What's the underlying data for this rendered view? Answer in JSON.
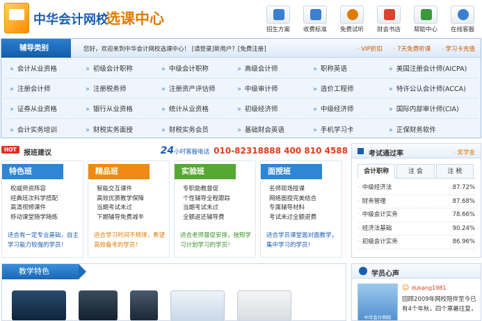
{
  "header": {
    "logo_text": "中华会计网校",
    "logo_sub": "选课中心",
    "nav": [
      {
        "label": "招生方案",
        "icon": "plan-icon",
        "color": "#3a7fd0"
      },
      {
        "label": "收费标准",
        "icon": "fee-icon",
        "color": "#3a7fd0"
      },
      {
        "label": "免费试听",
        "icon": "headphones-icon",
        "color": "#e07b00"
      },
      {
        "label": "财会书店",
        "icon": "book-icon",
        "color": "#d8442f"
      },
      {
        "label": "帮助中心",
        "icon": "help-icon",
        "color": "#3a9a3a"
      },
      {
        "label": "在线客服",
        "icon": "chat-icon",
        "color": "#3a7fd0"
      }
    ]
  },
  "category": {
    "title": "辅导类别",
    "welcome": "您好，欢迎来到中华会计网校选课中心！",
    "login": "[请登录]",
    "new_user": "新用户？",
    "register": "[免费注册]",
    "promos": [
      "· VIP折扣",
      "· 7天免费听课",
      "· 学习卡充值"
    ],
    "rows": [
      [
        "会计从业资格",
        "初级会计职称",
        "中级会计职称",
        "高级会计师",
        "职称英语",
        "美国注册会计师(AICPA)"
      ],
      [
        "注册会计师",
        "注册税务师",
        "注册资产评估师",
        "中级审计师",
        "造价工程师",
        "特许公认会计师(ACCA)"
      ],
      [
        "证券从业资格",
        "银行从业资格",
        "统计从业资格",
        "初级经济师",
        "中级经济师",
        "国际内部审计师(CIA)"
      ],
      [
        "会计实务培训",
        "财税实务面授",
        "财税实务会员",
        "基础财会英语",
        "手机学习卡",
        "正保财务软件"
      ]
    ]
  },
  "hot": {
    "badge": "HOT",
    "title": "报班建议",
    "hotline_24": "24",
    "hotline_label": "小时客服电话",
    "phone": "010-82318888  400 810 4588"
  },
  "cards": [
    {
      "title": "特色班",
      "color": "#2e86d6",
      "items": [
        "权威师资阵容",
        "经典班次科学搭配",
        "高清视频课件",
        "移动课堂随学随练"
      ],
      "foot": "适合有一定专业基础，自主学习能力较强的学员！",
      "foot_color": "#1a5dad"
    },
    {
      "title": "精品班",
      "color": "#f08a12",
      "items": [
        "智能交互课件",
        "高效优质教学保障",
        "当期考试未过",
        "下期辅导免费减半"
      ],
      "foot": "适合学习时间不规律，希望高效备考的学员！",
      "foot_color": "#e07b00"
    },
    {
      "title": "实验班",
      "color": "#56a832",
      "items": [
        "专职助教督促",
        "个性辅导全程跟踪",
        "当期考试未过",
        "全额返还辅导费"
      ],
      "foot": "适合老师督促安排，按照学习计划学习的学员！",
      "foot_color": "#3a8f2a"
    },
    {
      "title": "面授班",
      "color": "#2e86d6",
      "items": [
        "名师现场授课",
        "网络面授完美结合",
        "专属辅导材料",
        "考试未过全额退费"
      ],
      "foot": "适合学员课堂面对面教学，集中学习的学员！",
      "foot_color": "#1a5dad"
    }
  ],
  "rate": {
    "title": "考试通过率",
    "prize": "· 奖学金",
    "tabs": [
      "会计职称",
      "注 会",
      "注 税"
    ],
    "rows": [
      {
        "name": "中级经济法",
        "value": "87.72%"
      },
      {
        "name": "财务管理",
        "value": "87.68%"
      },
      {
        "name": "中级会计实务",
        "value": "78.66%"
      },
      {
        "name": "经济法基础",
        "value": "90.24%"
      },
      {
        "name": "初级会计实务",
        "value": "86.96%"
      }
    ]
  },
  "teach": {
    "title": "教学特色"
  },
  "voice": {
    "title": "学员心声",
    "avatar_caption": "中华会计网校",
    "user": "dukang1981",
    "text": "回顾2009年网校陪伴至今已有4个年秋，四个寒暑往复，"
  }
}
